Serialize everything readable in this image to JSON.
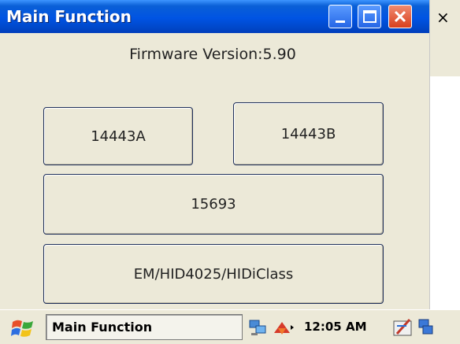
{
  "window": {
    "title": "Main Function",
    "controls": [
      "minimize-icon",
      "maximize-icon",
      "close-icon"
    ]
  },
  "right_strip": {
    "close_glyph": "×"
  },
  "main": {
    "firmware_label": "Firmware Version:5.90",
    "buttons": [
      "14443A",
      "14443B",
      "15693",
      "EM/HID4025/HIDiClass"
    ]
  },
  "taskbar": {
    "task_label": "Main Function",
    "clock": "12:05 AM",
    "icons": [
      "start-icon",
      "network-icon",
      "tool-icon",
      "pen-icon",
      "app-icon"
    ]
  },
  "colors": {
    "titlebar": "#0054e3",
    "window_bg": "#ece9d8",
    "close_button": "#d9401d"
  }
}
